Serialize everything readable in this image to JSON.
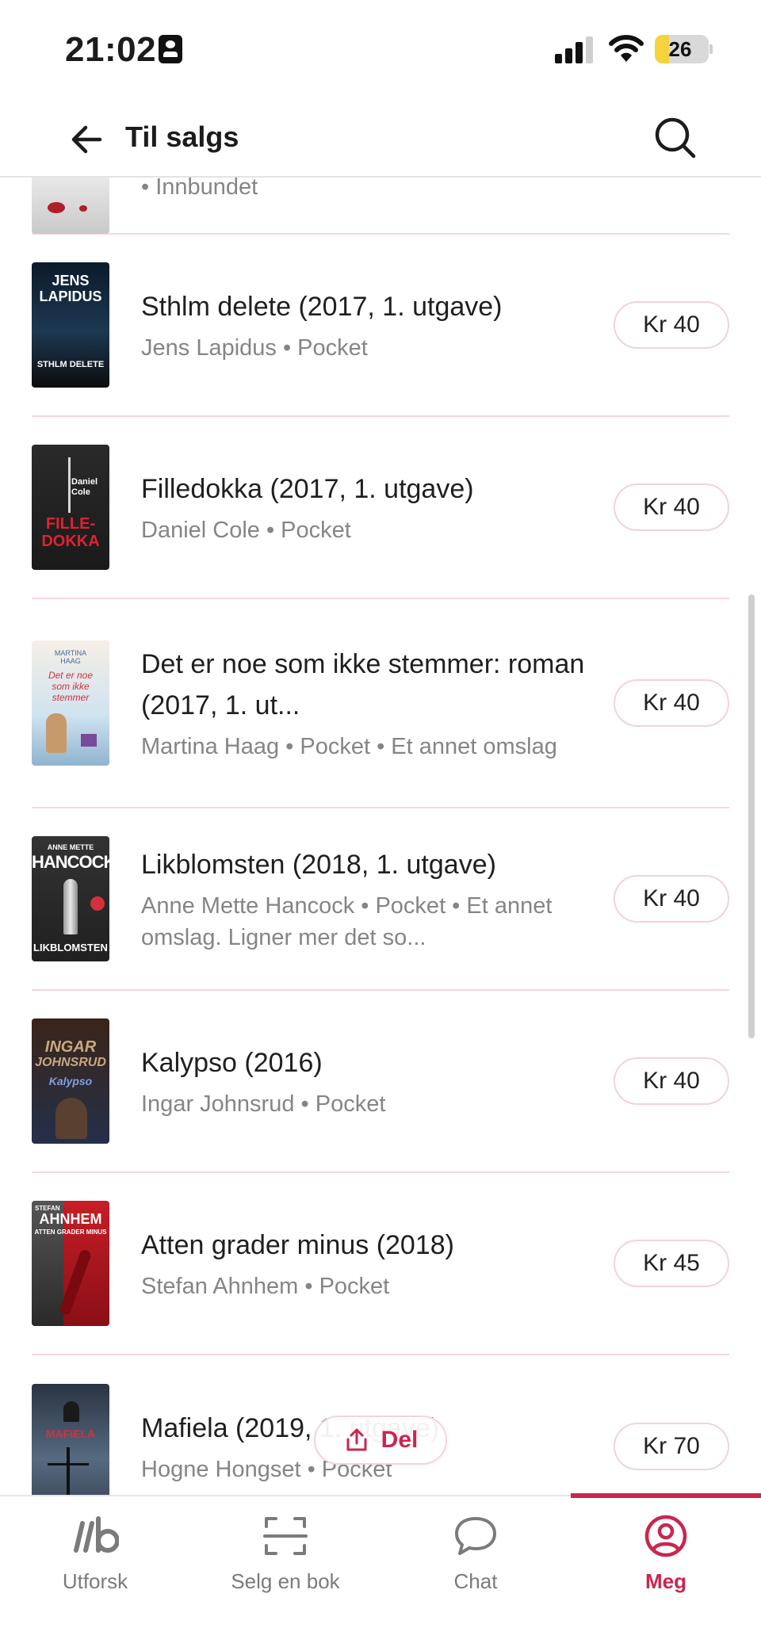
{
  "status_bar": {
    "time": "21:02",
    "battery": "26",
    "battery_level": 0.26
  },
  "header": {
    "title": "Til salgs"
  },
  "books": [
    {
      "title": "",
      "meta": "• Innbundet",
      "price": ""
    },
    {
      "title": "Sthlm delete (2017, 1. utgave)",
      "meta": "Jens Lapidus • Pocket",
      "price": "Kr 40",
      "cover_text": [
        "JENS",
        "LAPIDUS",
        "STHLM DELETE"
      ]
    },
    {
      "title": "Filledokka (2017, 1. utgave)",
      "meta": "Daniel Cole • Pocket",
      "price": "Kr 40",
      "cover_text": [
        "Daniel",
        "Cole",
        "FILLE-",
        "DOKKA"
      ]
    },
    {
      "title": "Det er noe som ikke stemmer: roman (2017, 1. ut...",
      "meta": "Martina Haag • Pocket • Et annet omslag",
      "price": "Kr 40",
      "cover_text": [
        "MARTINA",
        "HAAG",
        "Det er noe",
        "som ikke",
        "stemmer"
      ]
    },
    {
      "title": "Likblomsten (2018, 1. utgave)",
      "meta": "Anne Mette Hancock • Pocket • Et annet omslag. Ligner mer det so...",
      "price": "Kr 40",
      "cover_text": [
        "ANNE METTE",
        "HANCOCK",
        "LIKBLOMSTEN"
      ]
    },
    {
      "title": "Kalypso (2016)",
      "meta": "Ingar Johnsrud • Pocket",
      "price": "Kr 40",
      "cover_text": [
        "INGAR",
        "JOHNSRUD",
        "Kalypso"
      ]
    },
    {
      "title": "Atten grader minus (2018)",
      "meta": "Stefan Ahnhem • Pocket",
      "price": "Kr 45",
      "cover_text": [
        "STEFAN",
        "AHNHEM",
        "ATTEN GRADER MINUS"
      ]
    },
    {
      "title": "Mafiela (2019, 1. utgave)",
      "meta": "Hogne Hongset • Pocket",
      "price": "Kr 70",
      "cover_text": [
        "MAFIELA"
      ]
    }
  ],
  "share": {
    "label": "Del"
  },
  "nav": [
    {
      "label": "Utforsk",
      "icon": "logo-icon"
    },
    {
      "label": "Selg en bok",
      "icon": "scan-icon"
    },
    {
      "label": "Chat",
      "icon": "chat-icon"
    },
    {
      "label": "Meg",
      "icon": "profile-icon",
      "active": true
    }
  ],
  "colors": {
    "accent": "#c8274f",
    "divider": "#f5d6dd"
  }
}
